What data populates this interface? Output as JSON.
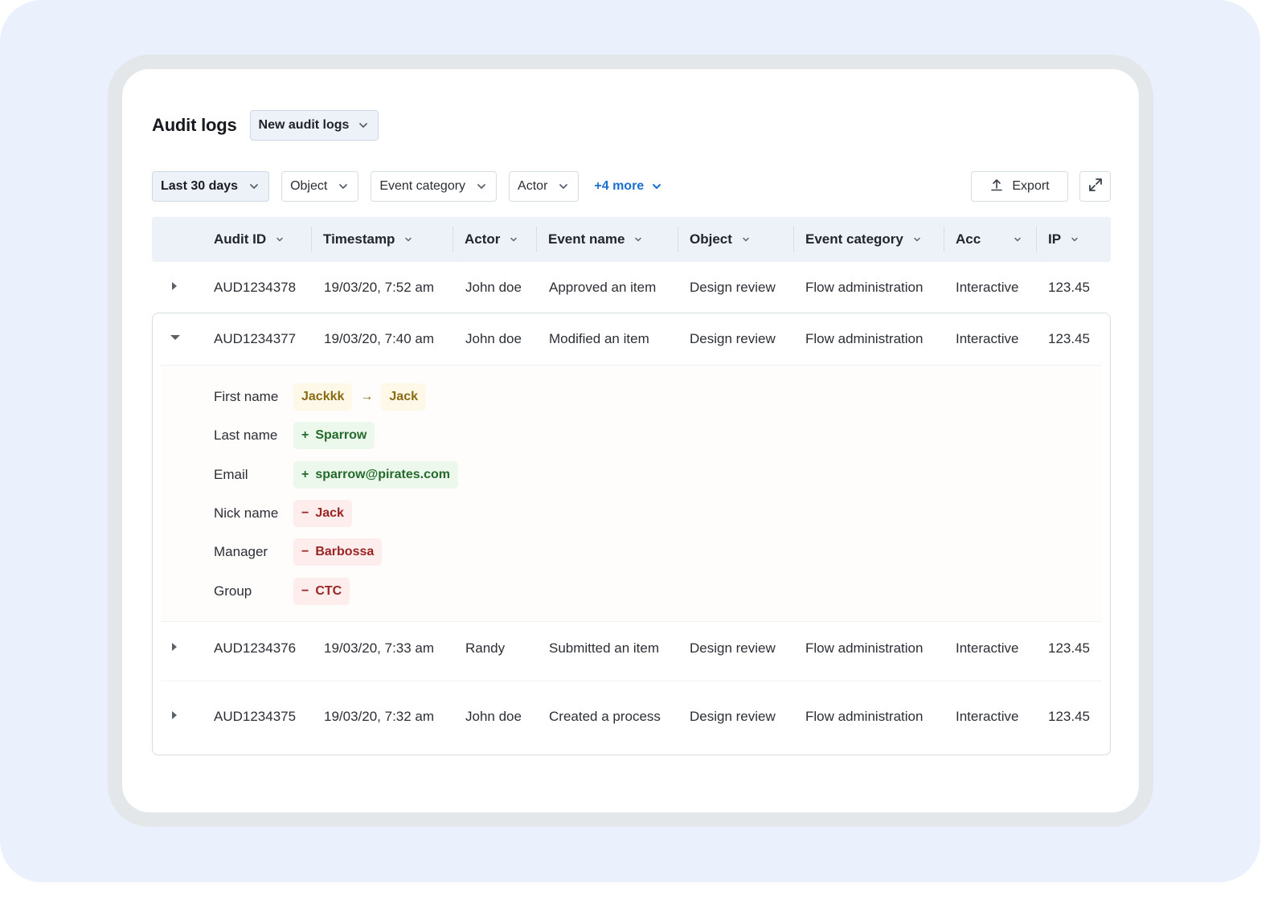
{
  "header": {
    "title": "Audit logs",
    "view_select": "New audit logs"
  },
  "filters": {
    "date_range": "Last 30 days",
    "object": "Object",
    "event_category": "Event category",
    "actor": "Actor",
    "more": "+4 more",
    "export": "Export"
  },
  "table": {
    "columns": [
      "Audit ID",
      "Timestamp",
      "Actor",
      "Event name",
      "Object",
      "Event category",
      "Acc",
      "IP"
    ],
    "rows": [
      {
        "id": "AUD1234378",
        "timestamp": "19/03/20, 7:52 am",
        "actor": "John doe",
        "event": "Approved an item",
        "object": "Design review",
        "category": "Flow administration",
        "acc": "Interactive",
        "ip": "123.45",
        "expanded": false
      },
      {
        "id": "AUD1234377",
        "timestamp": "19/03/20, 7:40 am",
        "actor": "John doe",
        "event": "Modified an item",
        "object": "Design review",
        "category": "Flow administration",
        "acc": "Interactive",
        "ip": "123.45",
        "expanded": true
      },
      {
        "id": "AUD1234376",
        "timestamp": "19/03/20, 7:33 am",
        "actor": "Randy",
        "event": "Submitted an item",
        "object": "Design review",
        "category": "Flow administration",
        "acc": "Interactive",
        "ip": "123.45",
        "expanded": false
      },
      {
        "id": "AUD1234375",
        "timestamp": "19/03/20, 7:32 am",
        "actor": "John doe",
        "event": "Created a process",
        "object": "Design review",
        "category": "Flow administration",
        "acc": "Interactive",
        "ip": "123.45",
        "expanded": false
      }
    ]
  },
  "details": {
    "first_name": {
      "label": "First name",
      "old": "Jackkk",
      "new": "Jack",
      "change": "modified"
    },
    "last_name": {
      "label": "Last name",
      "sign": "+",
      "value": "Sparrow",
      "change": "added"
    },
    "email": {
      "label": "Email",
      "sign": "+",
      "value": "sparrow@pirates.com",
      "change": "added"
    },
    "nick_name": {
      "label": "Nick name",
      "sign": "−",
      "value": "Jack",
      "change": "removed"
    },
    "manager": {
      "label": "Manager",
      "sign": "−",
      "value": "Barbossa",
      "change": "removed"
    },
    "group": {
      "label": "Group",
      "sign": "−",
      "value": "CTC",
      "change": "removed"
    },
    "arrow": "→"
  },
  "colors": {
    "accent": "#1a6fd1",
    "modified_bg": "#fdf8e8",
    "modified_text": "#8a6a12",
    "added_bg": "#ecf8ec",
    "added_text": "#256a2c",
    "removed_bg": "#fdeeed",
    "removed_text": "#9a2424"
  }
}
